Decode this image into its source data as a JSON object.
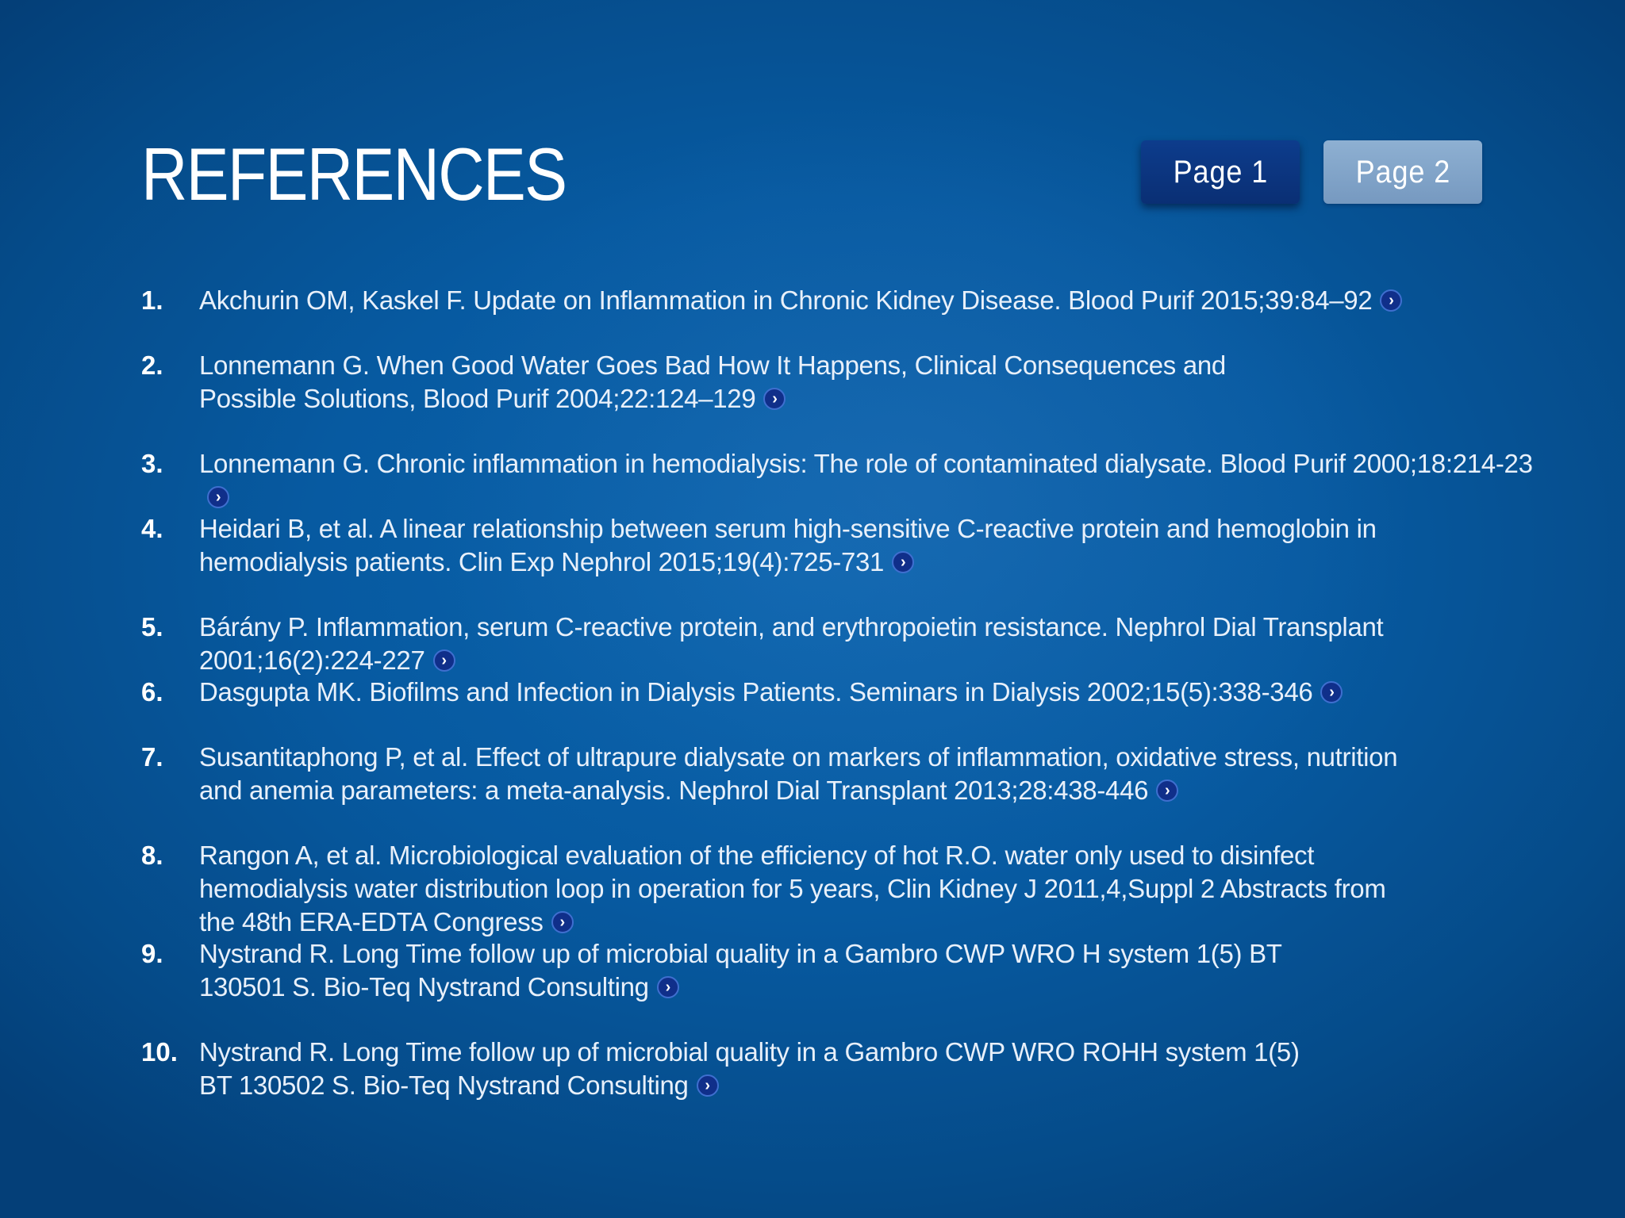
{
  "title": "REFERENCES",
  "pagination": {
    "page1_label": "Page 1",
    "page2_label": "Page 2",
    "active_page": 1
  },
  "link_icon_glyph": "›",
  "colors": {
    "background": "#075aa1",
    "active_button": "#0a2f74",
    "inactive_button": "#7e9fc5"
  },
  "references": [
    {
      "number": "1.",
      "text": "Akchurin OM, Kaskel F. Update on Inflammation in Chronic Kidney Disease. Blood Purif 2015;39:84–92"
    },
    {
      "number": "2.",
      "text": "Lonnemann G. When Good Water Goes Bad How It Happens, Clinical Consequences and Possible Solutions, Blood Purif 2004;22:124–129"
    },
    {
      "number": "3.",
      "text": "Lonnemann G. Chronic inflammation in hemodialysis: The role of contaminated dialysate. Blood Purif 2000;18:214-23"
    },
    {
      "number": "4.",
      "text": "Heidari B, et al. A linear relationship between serum high-sensitive C-reactive protein and hemoglobin in hemodialysis patients. Clin Exp Nephrol 2015;19(4):725-731"
    },
    {
      "number": "5.",
      "text": "Bárány P. Inflammation, serum C-reactive protein, and erythropoietin resistance. Nephrol Dial Transplant 2001;16(2):224-227"
    },
    {
      "number": "6.",
      "text": "Dasgupta MK. Biofilms and Infection in Dialysis Patients. Seminars in Dialysis 2002;15(5):338-346"
    },
    {
      "number": "7.",
      "text": "Susantitaphong P, et al. Effect of ultrapure dialysate on markers of inflammation, oxidative stress, nutrition and anemia parameters: a meta-analysis. Nephrol Dial Transplant 2013;28:438-446"
    },
    {
      "number": "8.",
      "text": "Rangon A, et al. Microbiological evaluation of the efficiency of hot R.O. water only used to disinfect hemodialysis water distribution loop in operation for 5 years, Clin Kidney J 2011,4,Suppl 2 Abstracts from the 48th ERA-EDTA Congress"
    },
    {
      "number": "9.",
      "text": "Nystrand R. Long Time follow up of microbial quality in a Gambro CWP WRO H system 1(5) BT 130501 S. Bio-Teq Nystrand Consulting"
    },
    {
      "number": "10.",
      "text": "Nystrand R. Long Time follow up of microbial quality in a Gambro CWP WRO ROHH system 1(5) BT 130502 S. Bio-Teq Nystrand Consulting"
    }
  ]
}
